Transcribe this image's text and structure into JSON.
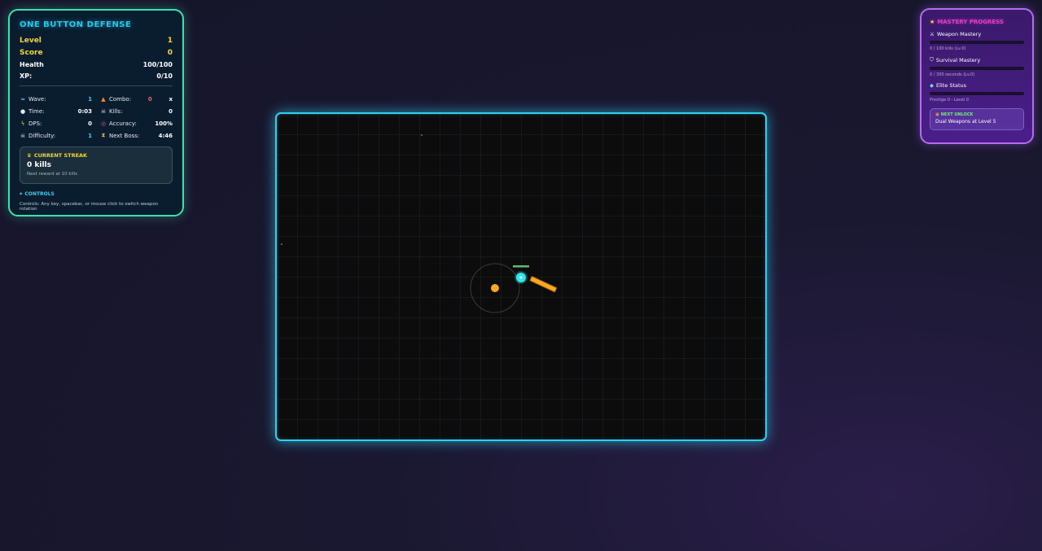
{
  "hud": {
    "title": "ONE BUTTON DEFENSE",
    "level_label": "Level",
    "level_value": "1",
    "score_label": "Score",
    "score_value": "0",
    "health_label": "Health",
    "health_value": "100/100",
    "xp_label": "XP:",
    "xp_value": "0/10",
    "wave_label": "Wave:",
    "wave_value": "1",
    "combo_label": "Combo:",
    "combo_value": "0",
    "combo_suffix": "x",
    "time_label": "Time:",
    "time_value": "0:03",
    "kills_label": "Kills:",
    "kills_value": "0",
    "dps_label": "DPS:",
    "dps_value": "0",
    "accuracy_label": "Accuracy:",
    "accuracy_value": "100%",
    "difficulty_label": "Difficulty:",
    "difficulty_value": "1",
    "boss_label": "Next Boss:",
    "boss_value": "4:46",
    "streak_title": "CURRENT STREAK",
    "streak_value": "0 kills",
    "streak_sub": "Next reward at 10 kills",
    "controls_title": "CONTROLS",
    "controls_text": "Controls: Any key, spacebar, or mouse click to switch weapon rotation"
  },
  "mastery": {
    "title": "MASTERY PROGRESS",
    "weapon_label": "Weapon Mastery",
    "weapon_progress": 0,
    "weapon_sub": "0 / 100 kills (Lv.0)",
    "survival_label": "Survival Mastery",
    "survival_progress": 0,
    "survival_sub": "0 / 300 seconds (Lv.0)",
    "elite_label": "Elite Status",
    "elite_progress": 0,
    "elite_sub": "Prestige 0 - Level 0",
    "unlock_title": "NEXT UNLOCK",
    "unlock_text": "Dual Weapons at Level 5"
  },
  "colors": {
    "accent_cyan": "#2fd0f0",
    "accent_green": "#3ee0b0",
    "accent_purple": "#b46cf0",
    "core": "#f7a81e",
    "orbiter": "#2ee6f0",
    "weapon": "#f7a81e",
    "health_bar": "#5cc06a"
  },
  "icons": {
    "wave": "wave-icon",
    "combo": "fire-icon",
    "time": "stopwatch-icon",
    "kills": "skull-icon",
    "dps": "lightning-icon",
    "accuracy": "target-icon",
    "difficulty": "skull-icon",
    "boss": "hourglass-icon",
    "streak": "trophy-icon",
    "controls": "gamepad-icon",
    "mastery": "star-icon",
    "weapon": "sword-icon",
    "survival": "shield-icon",
    "elite": "gem-icon",
    "unlock": "gift-icon"
  }
}
